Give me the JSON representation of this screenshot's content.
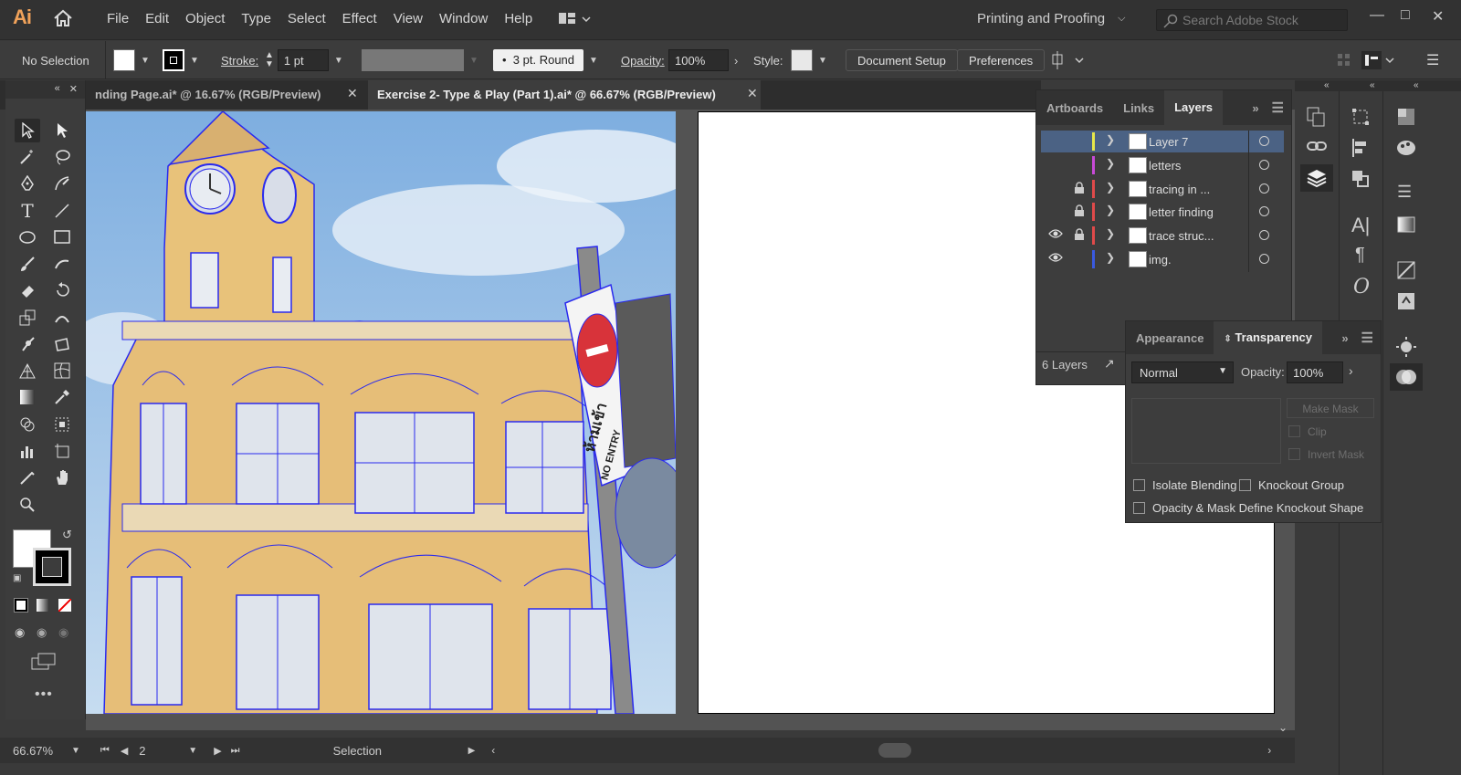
{
  "app": {
    "logo": "Ai",
    "workspace": "Printing and Proofing",
    "search_placeholder": "Search Adobe Stock"
  },
  "menu": [
    "File",
    "Edit",
    "Object",
    "Type",
    "Select",
    "Effect",
    "View",
    "Window",
    "Help"
  ],
  "control": {
    "selection": "No Selection",
    "stroke_label": "Stroke:",
    "stroke_value": "1 pt",
    "brush": "3 pt. Round",
    "opacity_label": "Opacity:",
    "opacity_value": "100%",
    "style_label": "Style:",
    "doc_setup": "Document Setup",
    "preferences": "Preferences"
  },
  "tabs": [
    {
      "label": "nding Page.ai* @ 16.67% (RGB/Preview)"
    },
    {
      "label": "Exercise 2- Type & Play (Part 1).ai* @ 66.67% (RGB/Preview)"
    }
  ],
  "layers": {
    "tabs": [
      "Artboards",
      "Links",
      "Layers"
    ],
    "rows": [
      {
        "name": "Layer 7",
        "color": "#e8e84a",
        "visible": false,
        "locked": false
      },
      {
        "name": "letters",
        "color": "#c84ad8",
        "visible": false,
        "locked": false
      },
      {
        "name": "tracing in ...",
        "color": "#e04a4a",
        "visible": false,
        "locked": true
      },
      {
        "name": "letter finding",
        "color": "#e04a4a",
        "visible": false,
        "locked": true
      },
      {
        "name": "trace struc...",
        "color": "#e04a4a",
        "visible": true,
        "locked": true
      },
      {
        "name": "img.",
        "color": "#3a5ae0",
        "visible": true,
        "locked": false
      }
    ],
    "count": "6 Layers"
  },
  "transparency": {
    "tabs": [
      "Appearance",
      "Transparency"
    ],
    "blend": "Normal",
    "opacity_label": "Opacity:",
    "opacity_value": "100%",
    "make_mask": "Make Mask",
    "clip": "Clip",
    "invert_mask": "Invert Mask",
    "isolate": "Isolate Blending",
    "knockout": "Knockout Group",
    "opacity_mask": "Opacity & Mask Define Knockout Shape"
  },
  "status": {
    "zoom": "66.67%",
    "artboard": "2",
    "tool": "Selection"
  },
  "sign": {
    "thai": "ห้ามเข้า",
    "english": "NO ENTRY"
  }
}
